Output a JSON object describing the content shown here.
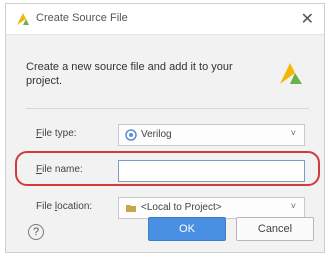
{
  "window": {
    "title": "Create Source File",
    "close_icon": "close-icon"
  },
  "description": "Create a new source file and add it to your project.",
  "form": {
    "file_type": {
      "label_prefix": "F",
      "label_rest": "ile type:",
      "value": "Verilog",
      "icon": "verilog-file-icon"
    },
    "file_name": {
      "label_prefix": "F",
      "label_rest": "ile name:",
      "value": "",
      "placeholder": ""
    },
    "file_location": {
      "label_prefix": "File ",
      "label_ul": "l",
      "label_rest": "ocation:",
      "value": "<Local to Project>",
      "icon": "folder-icon"
    }
  },
  "buttons": {
    "help": "?",
    "ok": "OK",
    "cancel": "Cancel"
  },
  "colors": {
    "accent": "#4a90e2",
    "highlight": "#d33a3a",
    "brand_yellow": "#f2b705",
    "brand_green": "#6ab04c"
  }
}
